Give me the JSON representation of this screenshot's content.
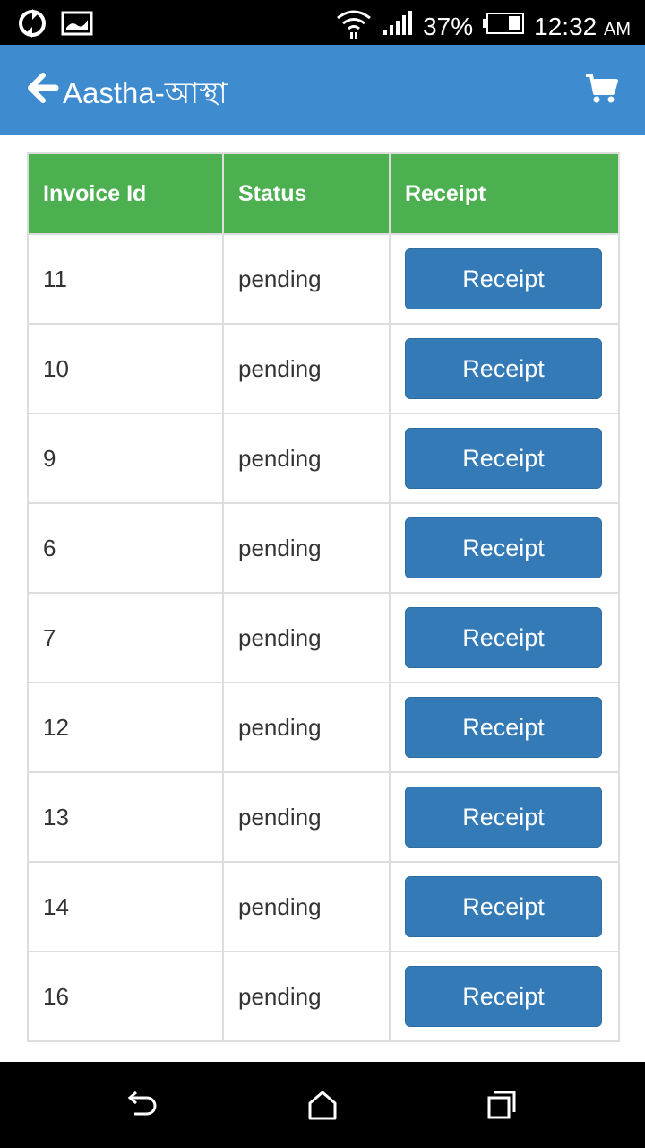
{
  "status_bar": {
    "battery": "37%",
    "time": "12:32",
    "ampm": "AM",
    "icons": [
      "sync-icon",
      "image-icon",
      "wifi-icon",
      "signal-icon",
      "battery-icon"
    ]
  },
  "header": {
    "title": "Aastha-আস্থা",
    "back_icon": "arrow-left-icon",
    "cart_icon": "cart-icon"
  },
  "colors": {
    "appbar": "#3e8bcf",
    "table_header": "#4cb050",
    "button": "#337ab7"
  },
  "table": {
    "columns": [
      "Invoice Id",
      "Status",
      "Receipt"
    ],
    "rows": [
      {
        "id": "11",
        "status": "pending",
        "receipt": "Receipt"
      },
      {
        "id": "10",
        "status": "pending",
        "receipt": "Receipt"
      },
      {
        "id": "9",
        "status": "pending",
        "receipt": "Receipt"
      },
      {
        "id": "6",
        "status": "pending",
        "receipt": "Receipt"
      },
      {
        "id": "7",
        "status": "pending",
        "receipt": "Receipt"
      },
      {
        "id": "12",
        "status": "pending",
        "receipt": "Receipt"
      },
      {
        "id": "13",
        "status": "pending",
        "receipt": "Receipt"
      },
      {
        "id": "14",
        "status": "pending",
        "receipt": "Receipt"
      },
      {
        "id": "16",
        "status": "pending",
        "receipt": "Receipt"
      }
    ]
  },
  "nav_bar": {
    "icons": [
      "back-nav-icon",
      "home-nav-icon",
      "recents-nav-icon"
    ]
  }
}
